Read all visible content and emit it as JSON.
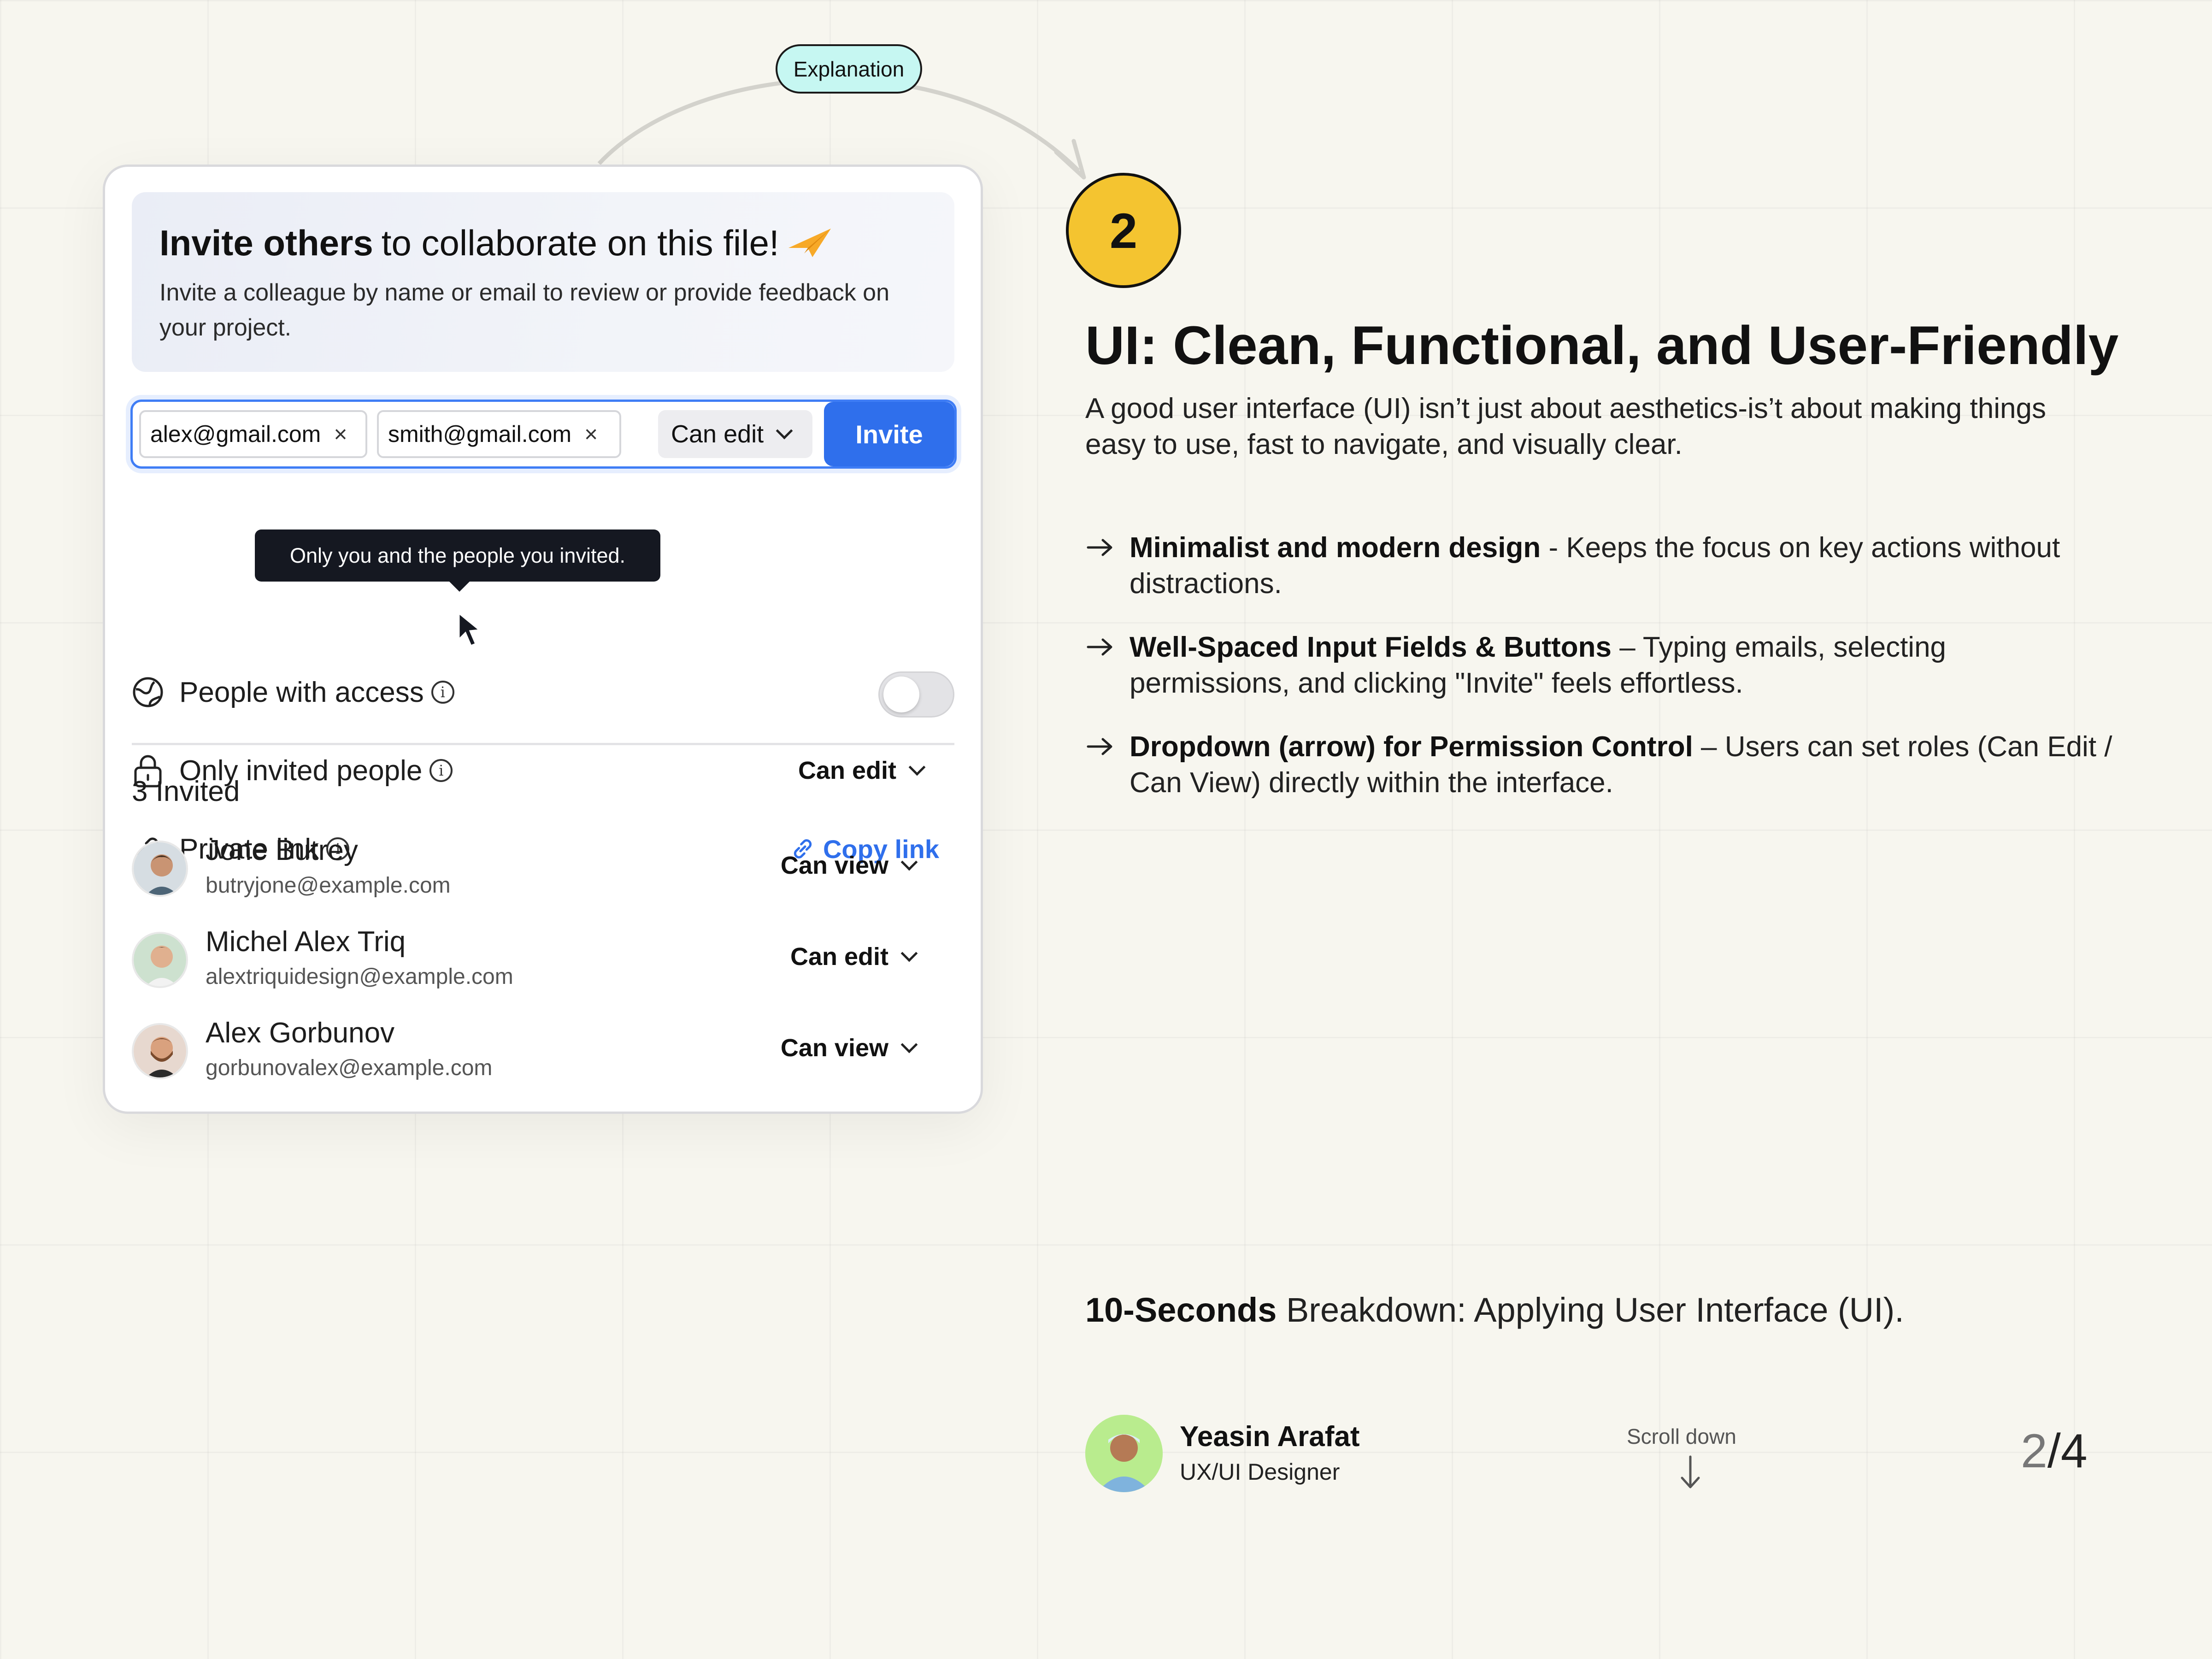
{
  "explanation_label": "Explanation",
  "card": {
    "title_bold": "Invite others",
    "title_rest": "to collaborate on this file!",
    "subtitle": "Invite a colleague by name or email to review or provide feedback on your project.",
    "invite_input": {
      "chips": [
        "alex@gmail.com",
        "smith@gmail.com"
      ],
      "chip_remove": "×",
      "permission": "Can edit",
      "invite_button": "Invite"
    },
    "access": {
      "people_with_access": "People with access",
      "only_invited": "Only invited people",
      "only_invited_permission": "Can edit",
      "private_link": "Private link",
      "copy_link": "Copy link",
      "tooltip": "Only you and the people you invited.",
      "toggle_on": false
    },
    "invited_title": "3 Invited",
    "people": [
      {
        "name": "Jone Butrey",
        "email": "butryjone@example.com",
        "permission": "Can view"
      },
      {
        "name": "Michel Alex Triq",
        "email": "alextriquidesign@example.com",
        "permission": "Can edit"
      },
      {
        "name": "Alex Gorbunov",
        "email": "gorbunovalex@example.com",
        "permission": "Can view"
      }
    ]
  },
  "step_number": "2",
  "title": "UI: Clean, Functional, and User-Friendly",
  "intro": "A good user interface (UI) isn’t just about aesthetics-is’t about making things easy to use, fast to navigate, and visually clear.",
  "bullets": [
    {
      "bold": "Minimalist and modern design",
      "text": " - Keeps the focus on key actions without distractions."
    },
    {
      "bold": "Well-Spaced Input Fields & Buttons",
      "text": " – Typing emails, selecting permissions, and clicking \"Invite\" feels effortless."
    },
    {
      "bold": "Dropdown (arrow) for Permission Control",
      "text": " – Users can set roles (Can Edit / Can View) directly within the interface."
    }
  ],
  "breakdown": {
    "bold": "10-Seconds",
    "text": " Breakdown: Applying User Interface (UI)."
  },
  "author": {
    "name": "Yeasin Arafat",
    "role": "UX/UI Designer"
  },
  "scroll_label": "Scroll down",
  "page": {
    "current": "2",
    "total": "/4"
  },
  "colors": {
    "accent_blue": "#2f6fec",
    "badge_yellow": "#f4c430",
    "pill_cyan": "#c6f7f2",
    "tooltip_bg": "#151821",
    "background": "#f7f6ef"
  }
}
